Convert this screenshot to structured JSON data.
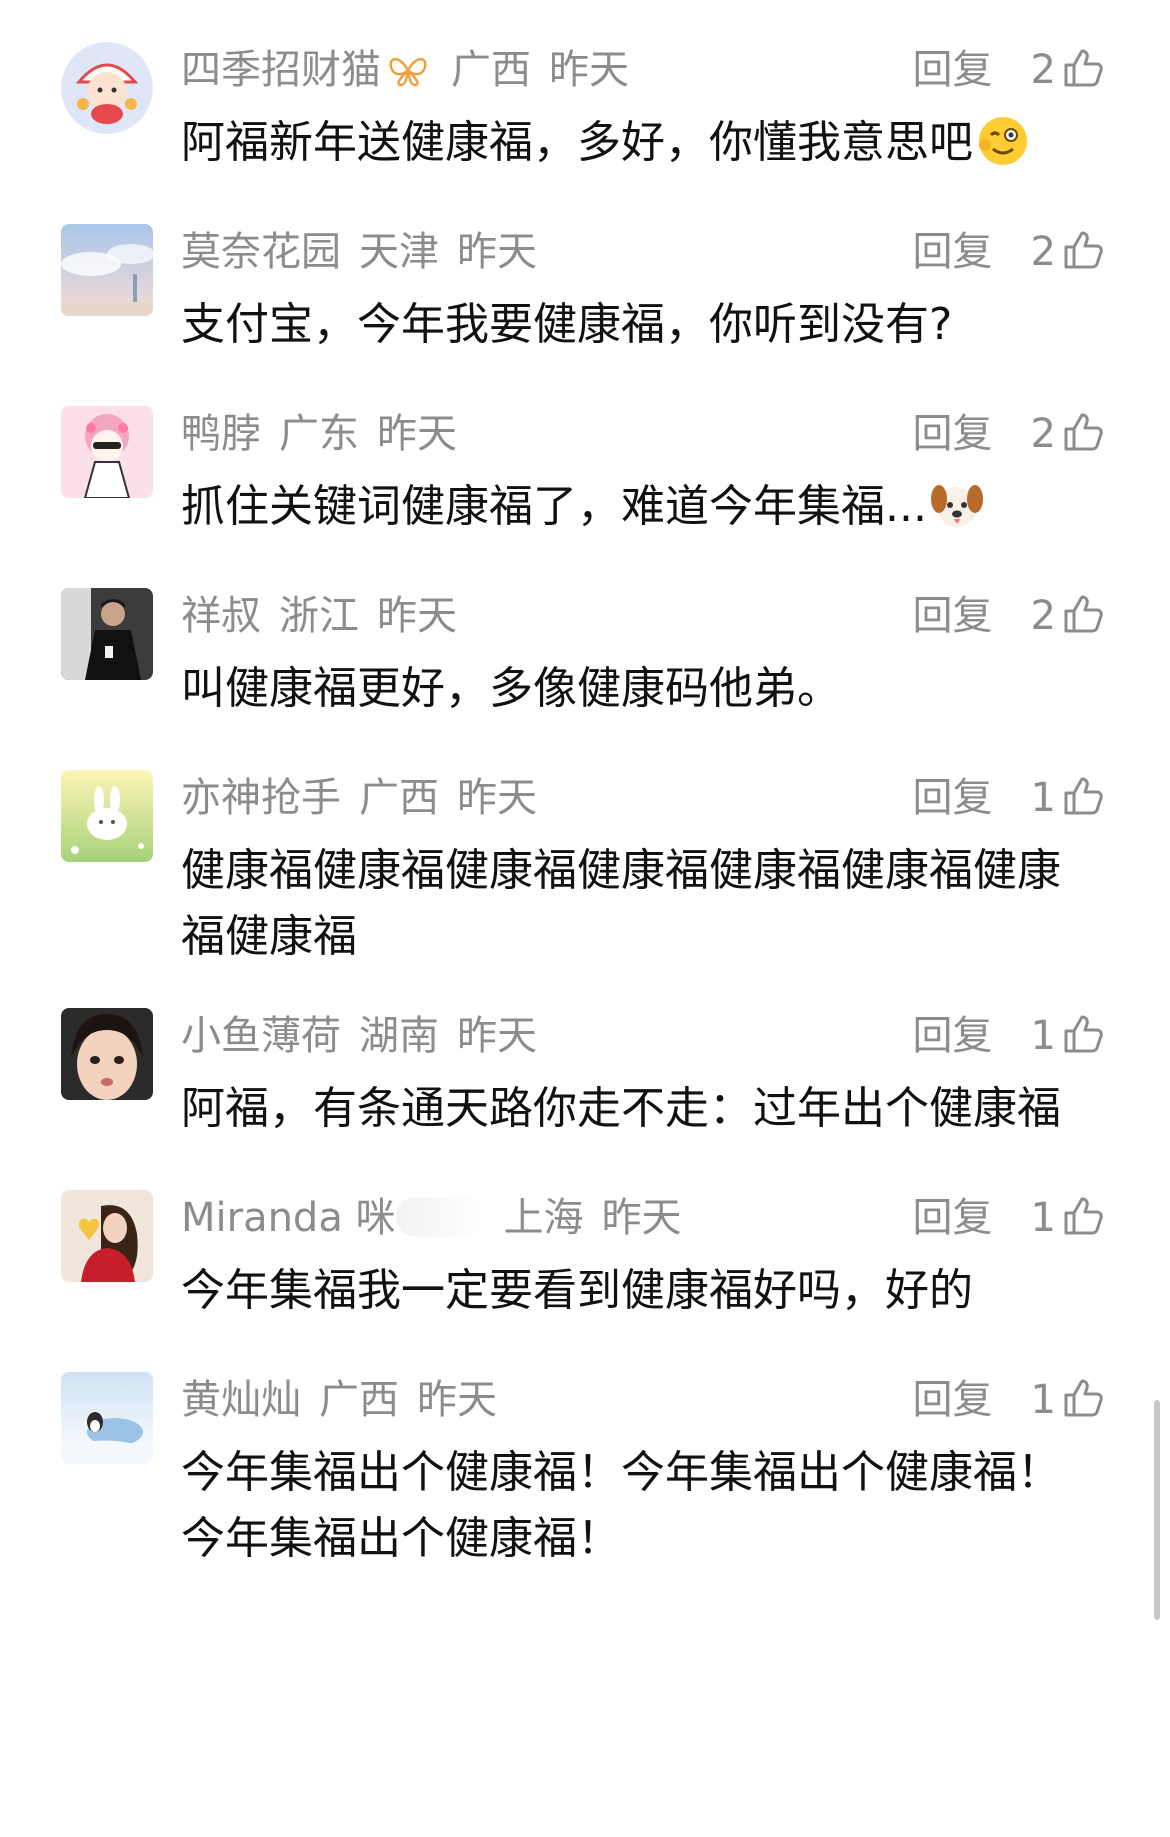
{
  "comments": [
    {
      "username": "四季招财猫",
      "location": "广西",
      "time": "昨天",
      "reply_label": "回复",
      "likes": "2",
      "text": "阿福新年送健康福，多好，你懂我意思吧",
      "avatar_icon": "lion-dance-child-avatar",
      "flair_icon": "butterfly-badge-icon",
      "emoji_icon": "wink-ok-emoji"
    },
    {
      "username": "莫奈花园",
      "location": "天津",
      "time": "昨天",
      "reply_label": "回复",
      "likes": "2",
      "text": "支付宝，今年我要健康福，你听到没有?",
      "avatar_icon": "pastel-sky-avatar"
    },
    {
      "username": "鸭脖",
      "location": "广东",
      "time": "昨天",
      "reply_label": "回复",
      "likes": "2",
      "text": "抓住关键词健康福了，难道今年集福...",
      "avatar_icon": "cartoon-girl-avatar",
      "emoji_icon": "dog-face-emoji"
    },
    {
      "username": "祥叔",
      "location": "浙江",
      "time": "昨天",
      "reply_label": "回复",
      "likes": "2",
      "text": "叫健康福更好，多像健康码他弟。",
      "avatar_icon": "man-in-black-avatar"
    },
    {
      "username": "亦神抢手",
      "location": "广西",
      "time": "昨天",
      "reply_label": "回复",
      "likes": "1",
      "text": "健康福健康福健康福健康福健康福健康福健康福健康福",
      "avatar_icon": "bunny-meadow-avatar"
    },
    {
      "username": "小鱼薄荷",
      "location": "湖南",
      "time": "昨天",
      "reply_label": "回复",
      "likes": "1",
      "text": "阿福，有条通天路你走不走：过年出个健康福",
      "avatar_icon": "girl-face-avatar"
    },
    {
      "username": "Miranda 咪",
      "location": "上海",
      "time": "昨天",
      "reply_label": "回复",
      "likes": "1",
      "text": "今年集福我一定要看到健康福好吗，好的",
      "avatar_icon": "girl-red-heart-avatar"
    },
    {
      "username": "黄灿灿",
      "location": "广西",
      "time": "昨天",
      "reply_label": "回复",
      "likes": "1",
      "text": "今年集福出个健康福！今年集福出个健康福！今年集福出个健康福！",
      "avatar_icon": "penguin-snow-avatar"
    }
  ],
  "colors": {
    "meta_text": "#8c8c8c",
    "body_text": "#111111",
    "background": "#ffffff",
    "scrollbar": "#c8c8c8"
  }
}
